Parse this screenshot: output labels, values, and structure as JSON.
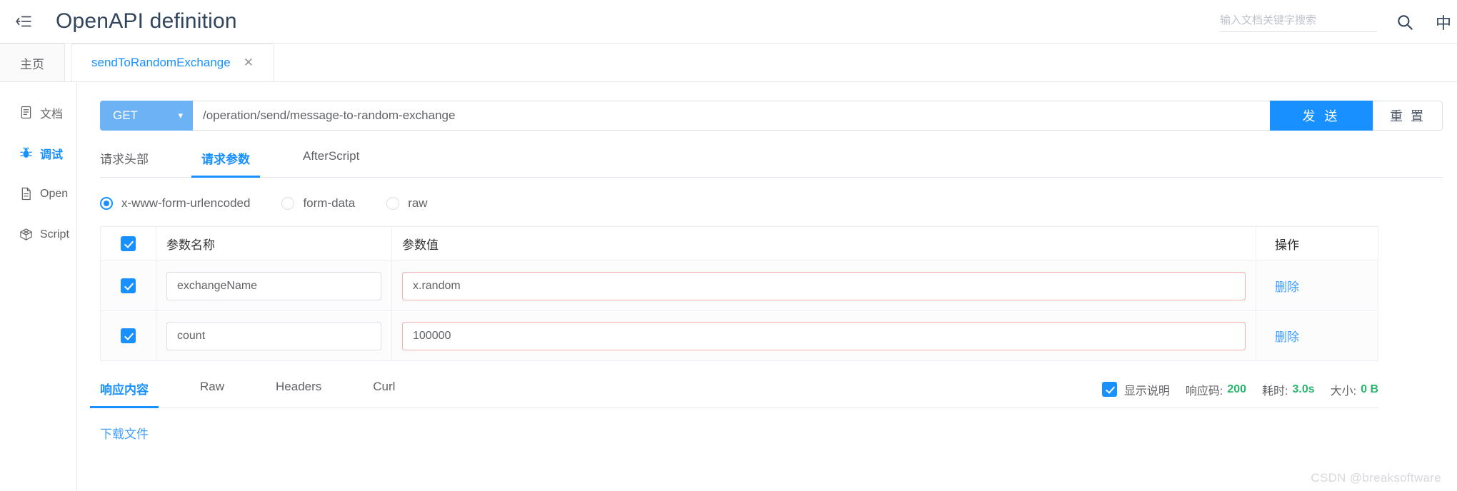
{
  "header": {
    "collapse_icon": "menu-fold-icon",
    "title": "OpenAPI definition",
    "search": {
      "placeholder": "输入文档关键字搜索",
      "value": "",
      "icon": "search-icon"
    },
    "lang_toggle": "中"
  },
  "doc_tabs": [
    {
      "label": "主页",
      "active": false,
      "closable": false
    },
    {
      "label": "sendToRandomExchange",
      "active": true,
      "closable": true,
      "close_icon": "close-icon"
    }
  ],
  "sidebar": {
    "items": [
      {
        "label": "文档",
        "icon": "document-icon",
        "active": false
      },
      {
        "label": "调试",
        "icon": "bug-icon",
        "active": true
      },
      {
        "label": "Open",
        "icon": "file-icon",
        "active": false
      },
      {
        "label": "Script",
        "icon": "cube-icon",
        "active": false
      }
    ]
  },
  "request": {
    "method": "GET",
    "method_chevron": "chevron-down-icon",
    "url": "/operation/send/message-to-random-exchange",
    "send_label": "发 送",
    "reset_label": "重 置",
    "tabs": [
      {
        "label": "请求头部",
        "active": false
      },
      {
        "label": "请求参数",
        "active": true
      },
      {
        "label": "AfterScript",
        "active": false
      }
    ],
    "body_types": [
      {
        "label": "x-www-form-urlencoded",
        "selected": true
      },
      {
        "label": "form-data",
        "selected": false
      },
      {
        "label": "raw",
        "selected": false
      }
    ],
    "params_table": {
      "select_all_checked": true,
      "columns": [
        "参数名称",
        "参数值",
        "操作"
      ],
      "rows": [
        {
          "checked": true,
          "name": "exchangeName",
          "value": "x.random",
          "action": "删除"
        },
        {
          "checked": true,
          "name": "count",
          "value": "100000",
          "action": "删除"
        }
      ]
    }
  },
  "response": {
    "tabs": [
      {
        "label": "响应内容",
        "active": true
      },
      {
        "label": "Raw",
        "active": false
      },
      {
        "label": "Headers",
        "active": false
      },
      {
        "label": "Curl",
        "active": false
      }
    ],
    "show_desc": {
      "label": "显示说明",
      "checked": true
    },
    "meta": [
      {
        "label": "响应码:",
        "value": "200"
      },
      {
        "label": "耗时:",
        "value": "3.0s"
      },
      {
        "label": "大小:",
        "value": "0 B"
      }
    ],
    "download_link": "下载文件"
  },
  "watermark": "CSDN @breaksoftware",
  "colors": {
    "primary": "#1890ff",
    "method_get": "#6cb2f5",
    "link": "#409eff",
    "status_green": "#29b56b",
    "warn_border": "#f0b0ad",
    "title": "#31455c"
  }
}
